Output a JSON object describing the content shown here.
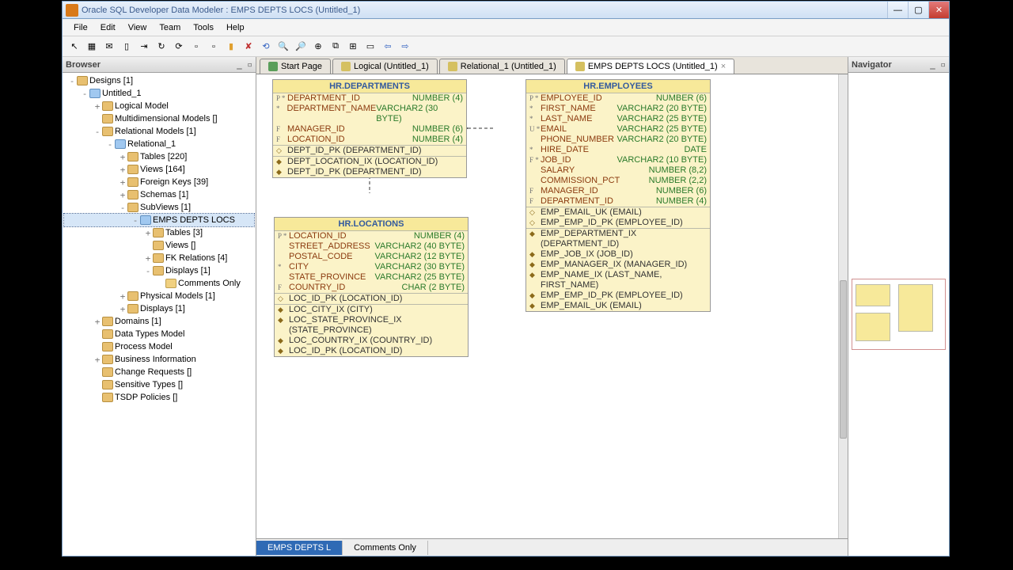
{
  "window": {
    "title": "Oracle SQL Developer Data Modeler : EMPS DEPTS LOCS (Untitled_1)"
  },
  "menu": [
    "File",
    "Edit",
    "View",
    "Team",
    "Tools",
    "Help"
  ],
  "panels": {
    "browser": "Browser",
    "navigator": "Navigator"
  },
  "tree": [
    {
      "d": 0,
      "tw": "-",
      "ic": "fold",
      "l": "Designs [1]"
    },
    {
      "d": 1,
      "tw": "-",
      "ic": "box",
      "l": "Untitled_1"
    },
    {
      "d": 2,
      "tw": "+",
      "ic": "fold",
      "l": "Logical Model"
    },
    {
      "d": 2,
      "tw": "",
      "ic": "fold",
      "l": "Multidimensional Models []"
    },
    {
      "d": 2,
      "tw": "-",
      "ic": "fold",
      "l": "Relational Models [1]"
    },
    {
      "d": 3,
      "tw": "-",
      "ic": "box",
      "l": "Relational_1"
    },
    {
      "d": 4,
      "tw": "+",
      "ic": "tbl",
      "l": "Tables [220]"
    },
    {
      "d": 4,
      "tw": "+",
      "ic": "tbl",
      "l": "Views [164]"
    },
    {
      "d": 4,
      "tw": "+",
      "ic": "tbl",
      "l": "Foreign Keys [39]"
    },
    {
      "d": 4,
      "tw": "+",
      "ic": "tbl",
      "l": "Schemas [1]"
    },
    {
      "d": 4,
      "tw": "-",
      "ic": "tbl",
      "l": "SubViews [1]"
    },
    {
      "d": 5,
      "tw": "-",
      "ic": "box",
      "l": "EMPS DEPTS LOCS"
    },
    {
      "d": 6,
      "tw": "+",
      "ic": "tbl",
      "l": "Tables [3]"
    },
    {
      "d": 6,
      "tw": "",
      "ic": "tbl",
      "l": "Views []"
    },
    {
      "d": 6,
      "tw": "+",
      "ic": "tbl",
      "l": "FK Relations [4]"
    },
    {
      "d": 6,
      "tw": "-",
      "ic": "tbl",
      "l": "Displays [1]"
    },
    {
      "d": 7,
      "tw": "",
      "ic": "leaf",
      "l": "Comments Only"
    },
    {
      "d": 4,
      "tw": "+",
      "ic": "tbl",
      "l": "Physical Models [1]"
    },
    {
      "d": 4,
      "tw": "+",
      "ic": "tbl",
      "l": "Displays [1]"
    },
    {
      "d": 2,
      "tw": "+",
      "ic": "fold",
      "l": "Domains [1]"
    },
    {
      "d": 2,
      "tw": "",
      "ic": "fold",
      "l": "Data Types Model"
    },
    {
      "d": 2,
      "tw": "",
      "ic": "fold",
      "l": "Process Model"
    },
    {
      "d": 2,
      "tw": "+",
      "ic": "fold",
      "l": "Business Information"
    },
    {
      "d": 2,
      "tw": "",
      "ic": "fold",
      "l": "Change Requests []"
    },
    {
      "d": 2,
      "tw": "",
      "ic": "fold",
      "l": "Sensitive Types []"
    },
    {
      "d": 2,
      "tw": "",
      "ic": "fold",
      "l": "TSDP Policies []"
    }
  ],
  "tabs": [
    {
      "icon": "#5a9e5a",
      "label": "Start Page"
    },
    {
      "icon": "#d5c060",
      "label": "Logical (Untitled_1)"
    },
    {
      "icon": "#d5c060",
      "label": "Relational_1 (Untitled_1)"
    },
    {
      "icon": "#d5c060",
      "label": "EMPS DEPTS LOCS (Untitled_1)",
      "active": true
    }
  ],
  "entities": {
    "dept": {
      "title": "HR.DEPARTMENTS",
      "cols": [
        {
          "k": "P *",
          "n": "DEPARTMENT_ID",
          "t": "NUMBER (4)"
        },
        {
          "k": "  *",
          "n": "DEPARTMENT_NAME",
          "t": "VARCHAR2 (30 BYTE)"
        },
        {
          "k": "F",
          "n": "MANAGER_ID",
          "t": "NUMBER (6)"
        },
        {
          "k": "F",
          "n": "LOCATION_ID",
          "t": "NUMBER (4)"
        }
      ],
      "pk": [
        "DEPT_ID_PK (DEPARTMENT_ID)"
      ],
      "idx": [
        "DEPT_LOCATION_IX (LOCATION_ID)",
        "DEPT_ID_PK (DEPARTMENT_ID)"
      ]
    },
    "emp": {
      "title": "HR.EMPLOYEES",
      "cols": [
        {
          "k": "P *",
          "n": "EMPLOYEE_ID",
          "t": "NUMBER (6)"
        },
        {
          "k": "  *",
          "n": "FIRST_NAME",
          "t": "VARCHAR2 (20 BYTE)"
        },
        {
          "k": "  *",
          "n": "LAST_NAME",
          "t": "VARCHAR2 (25 BYTE)"
        },
        {
          "k": "U *",
          "n": "EMAIL",
          "t": "VARCHAR2 (25 BYTE)"
        },
        {
          "k": "",
          "n": "PHONE_NUMBER",
          "t": "VARCHAR2 (20 BYTE)"
        },
        {
          "k": "  *",
          "n": "HIRE_DATE",
          "t": "DATE"
        },
        {
          "k": "F *",
          "n": "JOB_ID",
          "t": "VARCHAR2 (10 BYTE)"
        },
        {
          "k": "",
          "n": "SALARY",
          "t": "NUMBER (8,2)"
        },
        {
          "k": "",
          "n": "COMMISSION_PCT",
          "t": "NUMBER (2,2)"
        },
        {
          "k": "F",
          "n": "MANAGER_ID",
          "t": "NUMBER (6)"
        },
        {
          "k": "F",
          "n": "DEPARTMENT_ID",
          "t": "NUMBER (4)"
        }
      ],
      "pk": [
        "EMP_EMAIL_UK (EMAIL)",
        "EMP_EMP_ID_PK (EMPLOYEE_ID)"
      ],
      "idx": [
        "EMP_DEPARTMENT_IX (DEPARTMENT_ID)",
        "EMP_JOB_IX (JOB_ID)",
        "EMP_MANAGER_IX (MANAGER_ID)",
        "EMP_NAME_IX (LAST_NAME, FIRST_NAME)",
        "EMP_EMP_ID_PK (EMPLOYEE_ID)",
        "EMP_EMAIL_UK (EMAIL)"
      ]
    },
    "loc": {
      "title": "HR.LOCATIONS",
      "cols": [
        {
          "k": "P *",
          "n": "LOCATION_ID",
          "t": "NUMBER (4)"
        },
        {
          "k": "",
          "n": "STREET_ADDRESS",
          "t": "VARCHAR2 (40 BYTE)"
        },
        {
          "k": "",
          "n": "POSTAL_CODE",
          "t": "VARCHAR2 (12 BYTE)"
        },
        {
          "k": "  *",
          "n": "CITY",
          "t": "VARCHAR2 (30 BYTE)"
        },
        {
          "k": "",
          "n": "STATE_PROVINCE",
          "t": "VARCHAR2 (25 BYTE)"
        },
        {
          "k": "F",
          "n": "COUNTRY_ID",
          "t": "CHAR (2 BYTE)"
        }
      ],
      "pk": [
        "LOC_ID_PK (LOCATION_ID)"
      ],
      "idx": [
        "LOC_CITY_IX (CITY)",
        "LOC_STATE_PROVINCE_IX (STATE_PROVINCE)",
        "LOC_COUNTRY_IX (COUNTRY_ID)",
        "LOC_ID_PK (LOCATION_ID)"
      ]
    }
  },
  "bottom_tabs": [
    {
      "l": "EMPS DEPTS L",
      "active": true
    },
    {
      "l": "Comments Only"
    }
  ]
}
